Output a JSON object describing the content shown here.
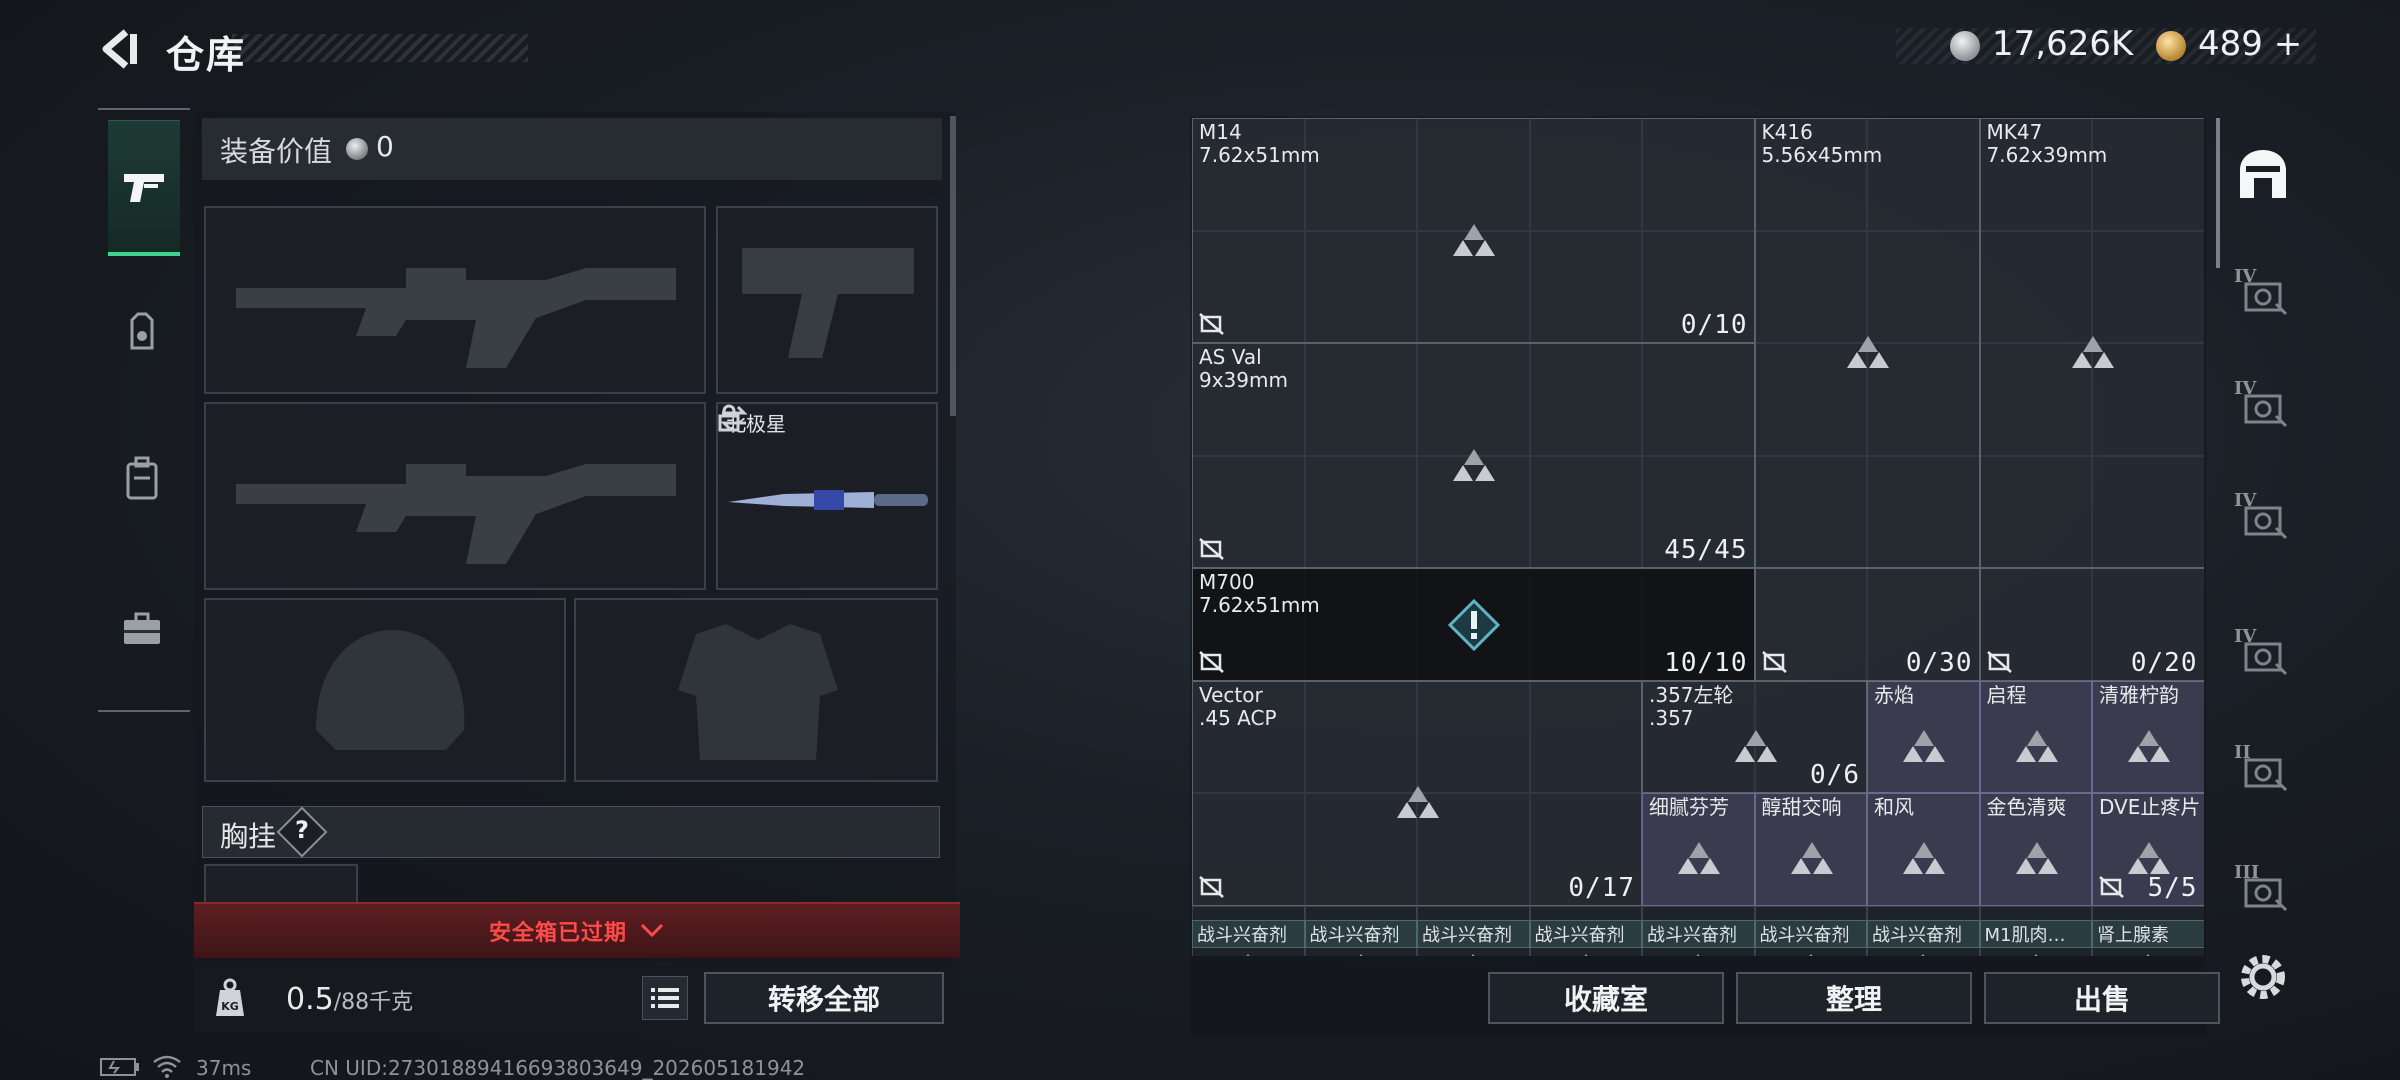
{
  "header": {
    "title": "仓库",
    "currency_silver": "17,626K",
    "currency_gold": "489",
    "currency_gold_plus": "+"
  },
  "equipment": {
    "value_label": "装备价值",
    "value": "0",
    "melee_name": "北极星",
    "chest_label": "胸挂",
    "chest_help": "?",
    "safebox_text": "安全箱已过期",
    "weight_current": "0.5",
    "weight_max": "/88千克",
    "transfer_all_label": "转移全部"
  },
  "storage": {
    "items": [
      {
        "name": "M14",
        "caliber": "7.62x51mm",
        "count": "0/10"
      },
      {
        "name": "K416",
        "caliber": "5.56x45mm",
        "count": ""
      },
      {
        "name": "MK47",
        "caliber": "7.62x39mm",
        "count": ""
      },
      {
        "name": "AS Val",
        "caliber": "9x39mm",
        "count": "45/45"
      },
      {
        "name": "M700",
        "caliber": "7.62x51mm",
        "count": "10/10"
      },
      {
        "name": "",
        "caliber": "",
        "count": "0/30"
      },
      {
        "name": "",
        "caliber": "",
        "count": "0/20"
      },
      {
        "name": "Vector",
        "caliber": ".45 ACP",
        "count": "0/17"
      },
      {
        "name": ".357左轮",
        "caliber": ".357",
        "count": "0/6"
      },
      {
        "name": "赤焰",
        "caliber": "",
        "count": ""
      },
      {
        "name": "启程",
        "caliber": "",
        "count": ""
      },
      {
        "name": "清雅柠韵",
        "caliber": "",
        "count": ""
      },
      {
        "name": "细腻芬芳",
        "caliber": "",
        "count": ""
      },
      {
        "name": "醇甜交响",
        "caliber": "",
        "count": ""
      },
      {
        "name": "和风",
        "caliber": "",
        "count": ""
      },
      {
        "name": "金色清爽",
        "caliber": "",
        "count": ""
      },
      {
        "name": "DVE止疼片",
        "caliber": "",
        "count": "5/5"
      }
    ],
    "bottom_strip": [
      "战斗兴奋剂",
      "战斗兴奋剂",
      "战斗兴奋剂",
      "战斗兴奋剂",
      "战斗兴奋剂",
      "战斗兴奋剂",
      "战斗兴奋剂",
      "M1肌肉…",
      "肾上腺素"
    ],
    "buttons": {
      "collection": "收藏室",
      "organize": "整理",
      "sell": "出售"
    }
  },
  "right_nav": {
    "tier_labels": [
      "IV",
      "IV",
      "IV",
      "IV",
      "II",
      "III"
    ]
  },
  "status": {
    "ping": "37ms",
    "uid": "CN UID:27301889416693803649_202605181942"
  },
  "colors": {
    "accent_green": "#3fd58c",
    "alert_red": "#ff4a4a",
    "rare_purple": "#46445e"
  }
}
